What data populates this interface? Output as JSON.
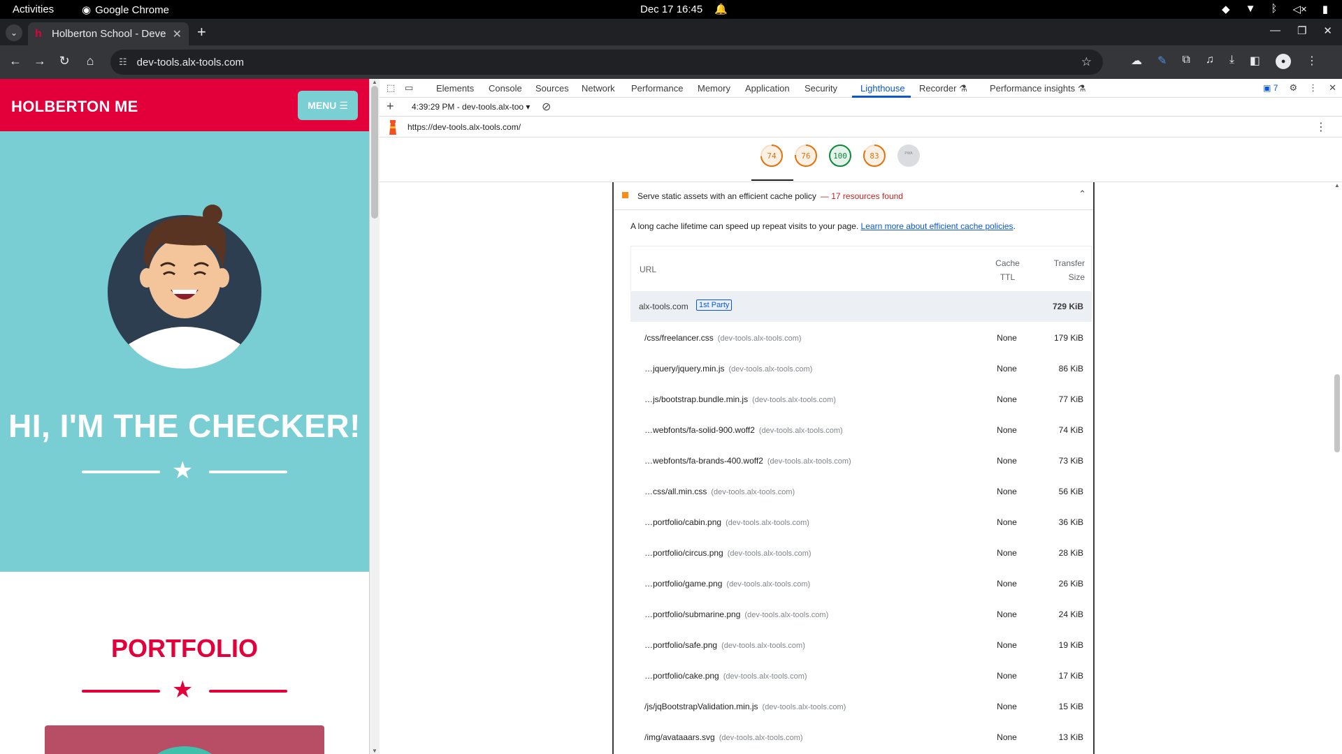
{
  "system": {
    "activities": "Activities",
    "app_name": "Google Chrome",
    "datetime": "Dec 17  16:45"
  },
  "browser": {
    "tab_title": "Holberton School - Deve",
    "url": "dev-tools.alx-tools.com"
  },
  "page": {
    "brand": "HOLBERTON ME",
    "menu_label": "MENU",
    "hero_title": "HI, I'M THE CHECKER!",
    "section_title": "PORTFOLIO",
    "colors": {
      "primary": "#e3003a",
      "hero_bg": "#79ced3"
    }
  },
  "devtools": {
    "tabs": [
      "Elements",
      "Console",
      "Sources",
      "Network",
      "Performance",
      "Memory",
      "Application",
      "Security",
      "Lighthouse",
      "Recorder",
      "Performance insights"
    ],
    "active_tab": "Lighthouse",
    "issues_count": "7",
    "run_label": "4:39:29 PM - dev-tools.alx-too",
    "report_url": "https://dev-tools.alx-tools.com/",
    "scores": [
      {
        "value": "74",
        "color": "#e8710a",
        "fraction": 0.74
      },
      {
        "value": "76",
        "color": "#e8710a",
        "fraction": 0.76
      },
      {
        "value": "100",
        "color": "#0c8a3a",
        "fraction": 1.0
      },
      {
        "value": "83",
        "color": "#e8710a",
        "fraction": 0.83
      },
      {
        "value": "PWA",
        "color": "#9aa0a6",
        "fraction": 0
      }
    ],
    "audit": {
      "title": "Serve static assets with an efficient cache policy",
      "display_value": "— 17 resources found",
      "description": "A long cache lifetime can speed up repeat visits to your page.",
      "learn_more": "Learn more about efficient cache policies",
      "learn_more_suffix": ".",
      "columns": {
        "url": "URL",
        "ttl": "Cache TTL",
        "size": "Transfer Size"
      },
      "group": {
        "name": "alx-tools.com",
        "badge": "1st Party",
        "total": "729 KiB"
      },
      "rows": [
        {
          "path": "/css/freelancer.css",
          "host": "(dev-tools.alx-tools.com)",
          "ttl": "None",
          "size": "179 KiB"
        },
        {
          "path": "…jquery/jquery.min.js",
          "host": "(dev-tools.alx-tools.com)",
          "ttl": "None",
          "size": "86 KiB"
        },
        {
          "path": "…js/bootstrap.bundle.min.js",
          "host": "(dev-tools.alx-tools.com)",
          "ttl": "None",
          "size": "77 KiB"
        },
        {
          "path": "…webfonts/fa-solid-900.woff2",
          "host": "(dev-tools.alx-tools.com)",
          "ttl": "None",
          "size": "74 KiB"
        },
        {
          "path": "…webfonts/fa-brands-400.woff2",
          "host": "(dev-tools.alx-tools.com)",
          "ttl": "None",
          "size": "73 KiB"
        },
        {
          "path": "…css/all.min.css",
          "host": "(dev-tools.alx-tools.com)",
          "ttl": "None",
          "size": "56 KiB"
        },
        {
          "path": "…portfolio/cabin.png",
          "host": "(dev-tools.alx-tools.com)",
          "ttl": "None",
          "size": "36 KiB"
        },
        {
          "path": "…portfolio/circus.png",
          "host": "(dev-tools.alx-tools.com)",
          "ttl": "None",
          "size": "28 KiB"
        },
        {
          "path": "…portfolio/game.png",
          "host": "(dev-tools.alx-tools.com)",
          "ttl": "None",
          "size": "26 KiB"
        },
        {
          "path": "…portfolio/submarine.png",
          "host": "(dev-tools.alx-tools.com)",
          "ttl": "None",
          "size": "24 KiB"
        },
        {
          "path": "…portfolio/safe.png",
          "host": "(dev-tools.alx-tools.com)",
          "ttl": "None",
          "size": "19 KiB"
        },
        {
          "path": "…portfolio/cake.png",
          "host": "(dev-tools.alx-tools.com)",
          "ttl": "None",
          "size": "17 KiB"
        },
        {
          "path": "/js/jqBootstrapValidation.min.js",
          "host": "(dev-tools.alx-tools.com)",
          "ttl": "None",
          "size": "15 KiB"
        },
        {
          "path": "/img/avataaars.svg",
          "host": "(dev-tools.alx-tools.com)",
          "ttl": "None",
          "size": "13 KiB"
        }
      ]
    }
  }
}
